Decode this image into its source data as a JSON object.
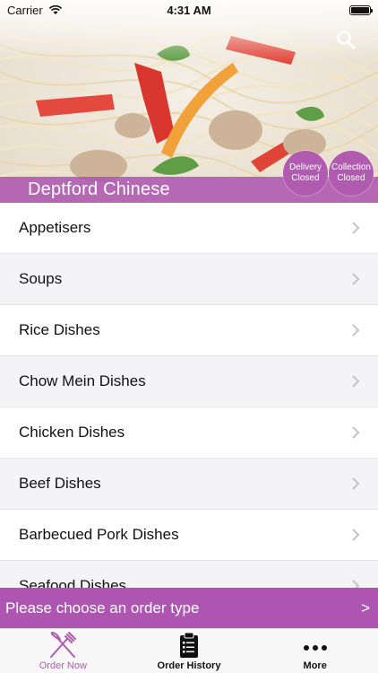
{
  "status_bar": {
    "carrier": "Carrier",
    "time": "4:31 AM"
  },
  "header": {
    "restaurant_name": "Deptford Chinese",
    "delivery_badge": [
      "Delivery",
      "Closed"
    ],
    "collection_badge": [
      "Collection",
      "Closed"
    ]
  },
  "menu": {
    "categories": [
      "Appetisers",
      "Soups",
      "Rice Dishes",
      "Chow Mein Dishes",
      "Chicken Dishes",
      "Beef Dishes",
      "Barbecued Pork Dishes",
      "Seafood Dishes"
    ]
  },
  "order_bar": {
    "text": "Please choose an order type",
    "arrow": ">"
  },
  "tabs": [
    {
      "label": "Order Now",
      "icon": "fork-knife-icon",
      "active": true
    },
    {
      "label": "Order History",
      "icon": "clipboard-icon",
      "active": false
    },
    {
      "label": "More",
      "icon": "more-dots-icon",
      "active": false
    }
  ],
  "colors": {
    "accent": "#b05ab0",
    "band": "#ac54b0",
    "alt_row": "#f4f4f6"
  }
}
